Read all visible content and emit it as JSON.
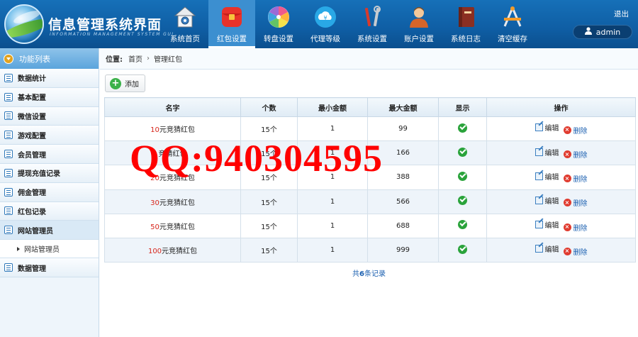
{
  "header": {
    "title": "信息管理系统界面",
    "subtitle": "INFORMATION MANAGEMENT SYSTEM GUI",
    "logout": "退出",
    "user": "admin",
    "nav": [
      {
        "label": "系统首页",
        "icon": "home-icon"
      },
      {
        "label": "红包设置",
        "icon": "red-envelope-icon",
        "active": true
      },
      {
        "label": "转盘设置",
        "icon": "wheel-icon"
      },
      {
        "label": "代理等级",
        "icon": "cloud-coin-icon"
      },
      {
        "label": "系统设置",
        "icon": "tools-icon"
      },
      {
        "label": "账户设置",
        "icon": "user-icon"
      },
      {
        "label": "系统日志",
        "icon": "book-icon"
      },
      {
        "label": "清空缓存",
        "icon": "compass-icon"
      }
    ]
  },
  "sidebar": {
    "title": "功能列表",
    "items": [
      {
        "label": "数据统计"
      },
      {
        "label": "基本配置"
      },
      {
        "label": "微信设置"
      },
      {
        "label": "游戏配置"
      },
      {
        "label": "会员管理"
      },
      {
        "label": "提现充值记录"
      },
      {
        "label": "佣金管理"
      },
      {
        "label": "红包记录"
      },
      {
        "label": "网站管理员"
      },
      {
        "label": "网站管理员",
        "sub": true
      },
      {
        "label": "数据管理"
      }
    ]
  },
  "breadcrumb": {
    "label": "位置:",
    "home": "首页",
    "separator": "›",
    "current": "管理红包"
  },
  "toolbar": {
    "add_label": "添加"
  },
  "table": {
    "headers": [
      "名字",
      "个数",
      "最小金额",
      "最大金额",
      "显示",
      "操作"
    ],
    "rows": [
      {
        "amount": "10",
        "name_suffix": "元竞猜红包",
        "count": "15个",
        "min": "1",
        "max": "99"
      },
      {
        "amount": "",
        "name_suffix": "竞猜红包",
        "count": "15个",
        "min": "1",
        "max": "166"
      },
      {
        "amount": "20",
        "name_suffix": "元竞猜红包",
        "count": "15个",
        "min": "1",
        "max": "388"
      },
      {
        "amount": "30",
        "name_suffix": "元竞猜红包",
        "count": "15个",
        "min": "1",
        "max": "566"
      },
      {
        "amount": "50",
        "name_suffix": "元竞猜红包",
        "count": "15个",
        "min": "1",
        "max": "688"
      },
      {
        "amount": "100",
        "name_suffix": "元竞猜红包",
        "count": "15个",
        "min": "1",
        "max": "999"
      }
    ],
    "edit_label": "编辑",
    "delete_label": "删除"
  },
  "footer": {
    "prefix": "共",
    "count": "6",
    "suffix": "条记录"
  },
  "watermark": "QQ:940304595",
  "colors": {
    "header": "#0f5ea4",
    "active_tab": "#3c8fd0",
    "amount": "#d7271d",
    "link": "#1a5fb0",
    "watermark": "#ff0000"
  }
}
